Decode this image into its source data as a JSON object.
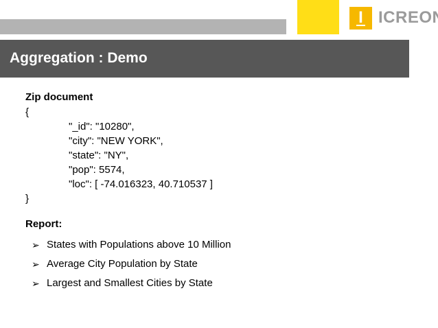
{
  "header": {
    "logo_text": "ICREON",
    "logo_mark": "I",
    "title": "Aggregation : Demo"
  },
  "zip": {
    "heading": "Zip document",
    "lines": [
      "{",
      "\"_id\": \"10280\",",
      "\"city\": \"NEW YORK\",",
      "\"state\": \"NY\",",
      "\"pop\": 5574,",
      "\"loc\": [ -74.016323, 40.710537 ]",
      "}"
    ]
  },
  "report": {
    "heading": "Report:",
    "bullet_icon": "arrowhead-bullet-icon",
    "items": [
      "States with Populations above 10 Million",
      "Average City Population by State",
      "Largest and Smallest Cities by State"
    ]
  },
  "colors": {
    "banner": "#575757",
    "accent_yellow": "#ffde17",
    "logo_orange": "#f6b800",
    "bar_gray": "#b3b3b3"
  }
}
